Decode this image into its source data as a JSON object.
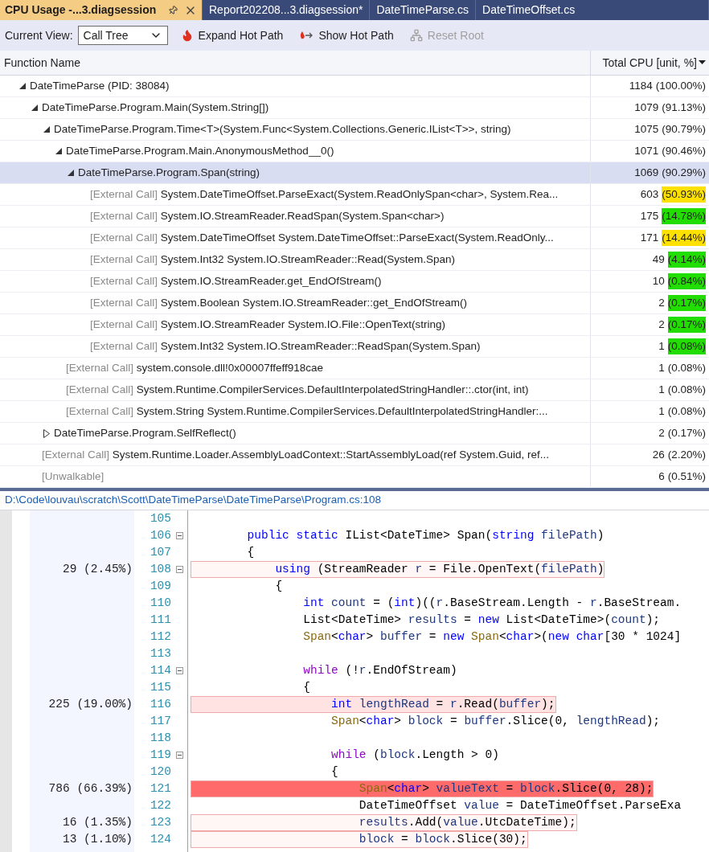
{
  "tabs": [
    {
      "label": "CPU Usage -...3.diagsession",
      "selected": true,
      "pinnable": true
    },
    {
      "label": "Report202208...3.diagsession*",
      "selected": false
    },
    {
      "label": "DateTimeParse.cs",
      "selected": false
    },
    {
      "label": "DateTimeOffset.cs",
      "selected": false
    }
  ],
  "toolbar": {
    "view_label": "Current View:",
    "view_value": "Call Tree",
    "buttons": [
      {
        "label": "Expand Hot Path",
        "kind": "expand",
        "disabled": false
      },
      {
        "label": "Show Hot Path",
        "kind": "show",
        "disabled": false
      },
      {
        "label": "Reset Root",
        "kind": "reset",
        "disabled": true
      }
    ]
  },
  "tree": {
    "columns": [
      "Function Name",
      "Total CPU [unit, %]"
    ],
    "rows": [
      {
        "name": "DateTimeParse (PID: 38084)",
        "count": "1184",
        "percent": "(100.00%)",
        "selected": false,
        "expanded": true,
        "children": [
          {
            "name": "DateTimeParse.Program.Main(System.String[])",
            "count": "1079",
            "percent": "(91.13%)",
            "selected": false,
            "expanded": true,
            "children": [
              {
                "name": "DateTimeParse.Program.Time<T>(System.Func<System.Collections.Generic.IList<T>>, string)",
                "count": "1075",
                "percent": "(90.79%)",
                "selected": false,
                "expanded": true,
                "children": [
                  {
                    "name": "DateTimeParse.Program.Main.AnonymousMethod__0()",
                    "count": "1071",
                    "percent": "(90.46%)",
                    "selected": false,
                    "expanded": true,
                    "children": [
                      {
                        "name": "DateTimeParse.Program.Span(string)",
                        "count": "1069",
                        "percent": "(90.29%)",
                        "selected": true,
                        "expanded": true,
                        "children": [
                          {
                            "prefix": "[External Call]",
                            "name": "System.DateTimeOffset.ParseExact(System.ReadOnlySpan<char>, System.Rea...",
                            "count": "603",
                            "percent": "(50.93%)",
                            "color": "#ffe100",
                            "selected": false
                          },
                          {
                            "prefix": "[External Call]",
                            "name": "System.IO.StreamReader.ReadSpan(System.Span<char>)",
                            "count": "175",
                            "percent": "(14.78%)",
                            "color": "#22dd00",
                            "selected": false
                          },
                          {
                            "prefix": "[External Call]",
                            "name": "System.DateTimeOffset System.DateTimeOffset::ParseExact(System.ReadOnly...",
                            "count": "171",
                            "percent": "(14.44%)",
                            "color": "#ffe100",
                            "selected": false
                          },
                          {
                            "prefix": "[External Call]",
                            "name": "System.Int32 System.IO.StreamReader::Read(System.Span)",
                            "count": "49",
                            "percent": "(4.14%)",
                            "color": "#22dd00",
                            "selected": false
                          },
                          {
                            "prefix": "[External Call]",
                            "name": "System.IO.StreamReader.get_EndOfStream()",
                            "count": "10",
                            "percent": "(0.84%)",
                            "color": "#22dd00",
                            "selected": false
                          },
                          {
                            "prefix": "[External Call]",
                            "name": "System.Boolean System.IO.StreamReader::get_EndOfStream()",
                            "count": "2",
                            "percent": "(0.17%)",
                            "color": "#22dd00",
                            "selected": false
                          },
                          {
                            "prefix": "[External Call]",
                            "name": "System.IO.StreamReader System.IO.File::OpenText(string)",
                            "count": "2",
                            "percent": "(0.17%)",
                            "color": "#22dd00",
                            "selected": false
                          },
                          {
                            "prefix": "[External Call]",
                            "name": "System.Int32 System.IO.StreamReader::ReadSpan(System.Span)",
                            "count": "1",
                            "percent": "(0.08%)",
                            "color": "#22dd00",
                            "selected": false
                          }
                        ]
                      }
                    ]
                  },
                  {
                    "prefix": "[External Call]",
                    "name": "system.console.dll!0x00007ffeff918cae",
                    "count": "1",
                    "percent": "(0.08%)",
                    "selected": false
                  },
                  {
                    "prefix": "[External Call]",
                    "name": "System.Runtime.CompilerServices.DefaultInterpolatedStringHandler::.ctor(int, int)",
                    "count": "1",
                    "percent": "(0.08%)",
                    "selected": false
                  },
                  {
                    "prefix": "[External Call]",
                    "name": "System.String System.Runtime.CompilerServices.DefaultInterpolatedStringHandler:...",
                    "count": "1",
                    "percent": "(0.08%)",
                    "selected": false
                  }
                ]
              },
              {
                "name": "DateTimeParse.Program.SelfReflect()",
                "count": "2",
                "percent": "(0.17%)",
                "selected": false,
                "expanded": false
              }
            ]
          },
          {
            "prefix": "[External Call]",
            "name": "System.Runtime.Loader.AssemblyLoadContext::StartAssemblyLoad(ref System.Guid, ref...",
            "count": "26",
            "percent": "(2.20%)",
            "selected": false
          },
          {
            "prefix": "[Unwalkable]",
            "count": "6",
            "percent": "(0.51%)",
            "selected": false
          }
        ]
      }
    ]
  },
  "source": {
    "path": "D:\\Code\\louvau\\scratch\\Scott\\DateTimeParse\\DateTimeParse\\Program.cs:108",
    "lines": [
      {
        "number": "105"
      },
      {
        "number": "106",
        "foldable": true,
        "segments": [
          {
            "text": "        public",
            "kind": "kw"
          },
          {
            "text": " static",
            "kind": "kw"
          },
          {
            "text": " IList<DateTime> Span(",
            "kind": "plain"
          },
          {
            "text": "string",
            "kind": "kw"
          },
          {
            "text": " filePath",
            "kind": "local"
          },
          {
            "text": ")",
            "kind": "plain"
          }
        ]
      },
      {
        "number": "107",
        "segments": [
          {
            "text": "        {",
            "kind": "plain"
          }
        ]
      },
      {
        "number": "108",
        "foldable": true,
        "hits": "29 (2.45%)",
        "color": "#fff6f6",
        "segments": [
          {
            "text": "            using",
            "kind": "kw"
          },
          {
            "text": " (StreamReader ",
            "kind": "plain"
          },
          {
            "text": "r",
            "kind": "local"
          },
          {
            "text": " = File.OpenText(",
            "kind": "plain"
          },
          {
            "text": "filePath",
            "kind": "local"
          },
          {
            "text": ")",
            "kind": "plain"
          }
        ]
      },
      {
        "number": "109",
        "segments": [
          {
            "text": "            {",
            "kind": "plain"
          }
        ]
      },
      {
        "number": "110",
        "segments": [
          {
            "text": "                int",
            "kind": "kw"
          },
          {
            "text": " count",
            "kind": "local"
          },
          {
            "text": " = (",
            "kind": "plain"
          },
          {
            "text": "int",
            "kind": "kw"
          },
          {
            "text": ")((",
            "kind": "plain"
          },
          {
            "text": "r",
            "kind": "local"
          },
          {
            "text": ".BaseStream.Length - ",
            "kind": "plain"
          },
          {
            "text": "r",
            "kind": "local"
          },
          {
            "text": ".BaseStream.",
            "kind": "plain"
          }
        ]
      },
      {
        "number": "111",
        "segments": [
          {
            "text": "                List<DateTime> ",
            "kind": "plain"
          },
          {
            "text": "results",
            "kind": "local"
          },
          {
            "text": " = ",
            "kind": "plain"
          },
          {
            "text": "new",
            "kind": "kw"
          },
          {
            "text": " List<DateTime>(",
            "kind": "plain"
          },
          {
            "text": "count",
            "kind": "local"
          },
          {
            "text": ");",
            "kind": "plain"
          }
        ]
      },
      {
        "number": "112",
        "segments": [
          {
            "text": "                Span",
            "kind": "struct"
          },
          {
            "text": "<",
            "kind": "plain"
          },
          {
            "text": "char",
            "kind": "kw"
          },
          {
            "text": "> ",
            "kind": "plain"
          },
          {
            "text": "buffer",
            "kind": "local"
          },
          {
            "text": " = ",
            "kind": "plain"
          },
          {
            "text": "new",
            "kind": "kw"
          },
          {
            "text": " Span",
            "kind": "struct"
          },
          {
            "text": "<",
            "kind": "plain"
          },
          {
            "text": "char",
            "kind": "kw"
          },
          {
            "text": ">(",
            "kind": "plain"
          },
          {
            "text": "new",
            "kind": "kw"
          },
          {
            "text": " char",
            "kind": "kw"
          },
          {
            "text": "[30 * 1024]",
            "kind": "plain"
          }
        ]
      },
      {
        "number": "113"
      },
      {
        "number": "114",
        "foldable": true,
        "segments": [
          {
            "text": "                while",
            "kind": "ctl"
          },
          {
            "text": " (!",
            "kind": "plain"
          },
          {
            "text": "r",
            "kind": "local"
          },
          {
            "text": ".EndOfStream)",
            "kind": "plain"
          }
        ]
      },
      {
        "number": "115",
        "segments": [
          {
            "text": "                {",
            "kind": "plain"
          }
        ]
      },
      {
        "number": "116",
        "hits": "225 (19.00%)",
        "color": "#ffe3e3",
        "segments": [
          {
            "text": "                    int",
            "kind": "kw"
          },
          {
            "text": " lengthRead",
            "kind": "local"
          },
          {
            "text": " = ",
            "kind": "plain"
          },
          {
            "text": "r",
            "kind": "local"
          },
          {
            "text": ".Read(",
            "kind": "plain"
          },
          {
            "text": "buffer",
            "kind": "local"
          },
          {
            "text": ");",
            "kind": "plain"
          }
        ]
      },
      {
        "number": "117",
        "segments": [
          {
            "text": "                    Span",
            "kind": "struct"
          },
          {
            "text": "<",
            "kind": "plain"
          },
          {
            "text": "char",
            "kind": "kw"
          },
          {
            "text": "> ",
            "kind": "plain"
          },
          {
            "text": "block",
            "kind": "local"
          },
          {
            "text": " = ",
            "kind": "plain"
          },
          {
            "text": "buffer",
            "kind": "local"
          },
          {
            "text": ".Slice(0, ",
            "kind": "plain"
          },
          {
            "text": "lengthRead",
            "kind": "local"
          },
          {
            "text": ");",
            "kind": "plain"
          }
        ]
      },
      {
        "number": "118"
      },
      {
        "number": "119",
        "foldable": true,
        "segments": [
          {
            "text": "                    while",
            "kind": "ctl"
          },
          {
            "text": " (",
            "kind": "plain"
          },
          {
            "text": "block",
            "kind": "local"
          },
          {
            "text": ".Length > 0)",
            "kind": "plain"
          }
        ]
      },
      {
        "number": "120",
        "segments": [
          {
            "text": "                    {",
            "kind": "plain"
          }
        ]
      },
      {
        "number": "121",
        "hits": "786 (66.39%)",
        "color": "#ff6b6b",
        "segments": [
          {
            "text": "                        Span",
            "kind": "struct"
          },
          {
            "text": "<",
            "kind": "plain"
          },
          {
            "text": "char",
            "kind": "kw"
          },
          {
            "text": "> ",
            "kind": "plain"
          },
          {
            "text": "valueText",
            "kind": "local"
          },
          {
            "text": " = ",
            "kind": "plain"
          },
          {
            "text": "block",
            "kind": "local"
          },
          {
            "text": ".Slice(0, 28);",
            "kind": "plain"
          }
        ]
      },
      {
        "number": "122",
        "segments": [
          {
            "text": "                        DateTimeOffset ",
            "kind": "plain"
          },
          {
            "text": "value",
            "kind": "local"
          },
          {
            "text": " = DateTimeOffset.ParseExa",
            "kind": "plain"
          }
        ]
      },
      {
        "number": "123",
        "hits": "16 (1.35%)",
        "color": "#fff6f6",
        "segments": [
          {
            "text": "                        results",
            "kind": "local"
          },
          {
            "text": ".Add(",
            "kind": "plain"
          },
          {
            "text": "value",
            "kind": "local"
          },
          {
            "text": ".UtcDateTime);",
            "kind": "plain"
          }
        ]
      },
      {
        "number": "124",
        "hits": "13 (1.10%)",
        "color": "#fff6f6",
        "segments": [
          {
            "text": "                        block",
            "kind": "local"
          },
          {
            "text": " = ",
            "kind": "plain"
          },
          {
            "text": "block",
            "kind": "local"
          },
          {
            "text": ".Slice(30);",
            "kind": "plain"
          }
        ]
      }
    ]
  }
}
